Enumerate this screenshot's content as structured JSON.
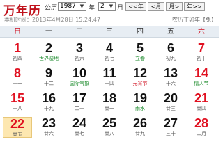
{
  "header": {
    "title": "万年历",
    "gregorian_label": "公历",
    "year_value": "1987",
    "year_label": "年",
    "month_value": "2",
    "month_label": "月",
    "btn_prev_year": "<<年",
    "btn_prev_month": "<月",
    "btn_next_month": "月>",
    "btn_next_year": "年>>",
    "now_text": "本机时间：2013年4月28日 15:24:47",
    "lunar_year": "农历丁卯年【兔】"
  },
  "weekdays": [
    "日",
    "一",
    "二",
    "三",
    "四",
    "五",
    "六"
  ],
  "days": [
    {
      "day": "1",
      "sub": "初四"
    },
    {
      "day": "2",
      "sub": "世界湿地"
    },
    {
      "day": "3",
      "sub": "初六"
    },
    {
      "day": "4",
      "sub": "初七"
    },
    {
      "day": "5",
      "sub": "立春"
    },
    {
      "day": "6",
      "sub": "初九"
    },
    {
      "day": "7",
      "sub": "初十"
    },
    {
      "day": "8",
      "sub": "十一"
    },
    {
      "day": "9",
      "sub": "十二"
    },
    {
      "day": "10",
      "sub": "国际气象"
    },
    {
      "day": "11",
      "sub": "十四"
    },
    {
      "day": "12",
      "sub": "元宵节"
    },
    {
      "day": "13",
      "sub": "十六"
    },
    {
      "day": "14",
      "sub": "情人节"
    },
    {
      "day": "15",
      "sub": "十八"
    },
    {
      "day": "16",
      "sub": "十九"
    },
    {
      "day": "17",
      "sub": "二十"
    },
    {
      "day": "18",
      "sub": "廿一"
    },
    {
      "day": "19",
      "sub": "雨水"
    },
    {
      "day": "20",
      "sub": "廿三"
    },
    {
      "day": "21",
      "sub": "廿四"
    },
    {
      "day": "22",
      "sub": "廿五"
    },
    {
      "day": "23",
      "sub": "廿六"
    },
    {
      "day": "24",
      "sub": "廿七"
    },
    {
      "day": "25",
      "sub": "廿八"
    },
    {
      "day": "26",
      "sub": "廿九"
    },
    {
      "day": "27",
      "sub": "三十"
    },
    {
      "day": "28",
      "sub": "二月"
    }
  ],
  "colors": {
    "weekend_red": "#e01020",
    "festival_green": "#1a8a2a",
    "today_bg": "#fde7b0"
  }
}
